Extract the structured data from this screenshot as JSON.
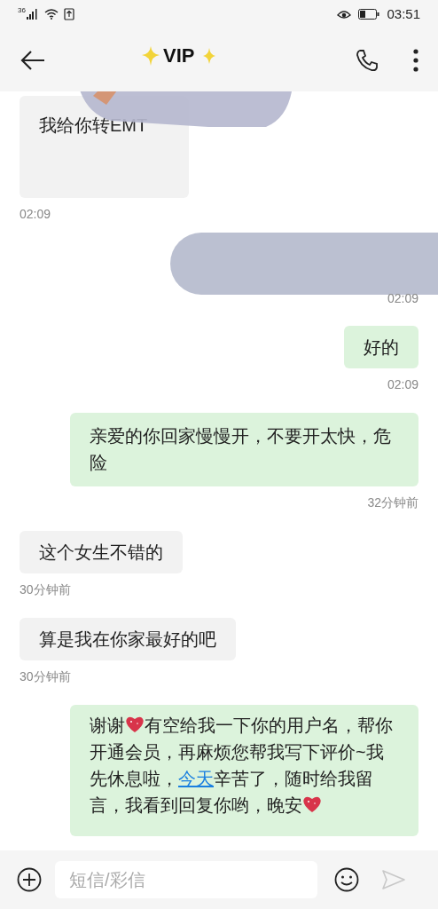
{
  "status_bar": {
    "network": "36",
    "time": "03:51"
  },
  "header": {
    "title": "VIP"
  },
  "messages": [
    {
      "outgoing": false,
      "kind": "text",
      "text": "我给你转EMT",
      "time": "02:09",
      "tall": true
    },
    {
      "outgoing": true,
      "kind": "redacted",
      "time": "02:09"
    },
    {
      "outgoing": true,
      "kind": "text",
      "text": "好的",
      "time": "02:09"
    },
    {
      "outgoing": true,
      "kind": "text",
      "text": "亲爱的你回家慢慢开，不要开太快，危险",
      "time": "32分钟前"
    },
    {
      "outgoing": false,
      "kind": "text",
      "text": "这个女生不错的",
      "time": "30分钟前"
    },
    {
      "outgoing": false,
      "kind": "text",
      "text": "算是我在你家最好的吧",
      "time": "30分钟前"
    },
    {
      "outgoing": true,
      "kind": "rich",
      "parts": [
        {
          "kind": "text",
          "text": "谢谢"
        },
        {
          "kind": "heart"
        },
        {
          "kind": "text",
          "text": "有空给我一下你的用户名，帮你开通会员，再麻烦您帮我写下评价~我先休息啦，"
        },
        {
          "kind": "link",
          "text": "今天"
        },
        {
          "kind": "text",
          "text": "辛苦了，随时给我留言，我看到回复你哟，晚安"
        },
        {
          "kind": "heart"
        }
      ]
    }
  ],
  "composer": {
    "placeholder": "短信/彩信"
  }
}
